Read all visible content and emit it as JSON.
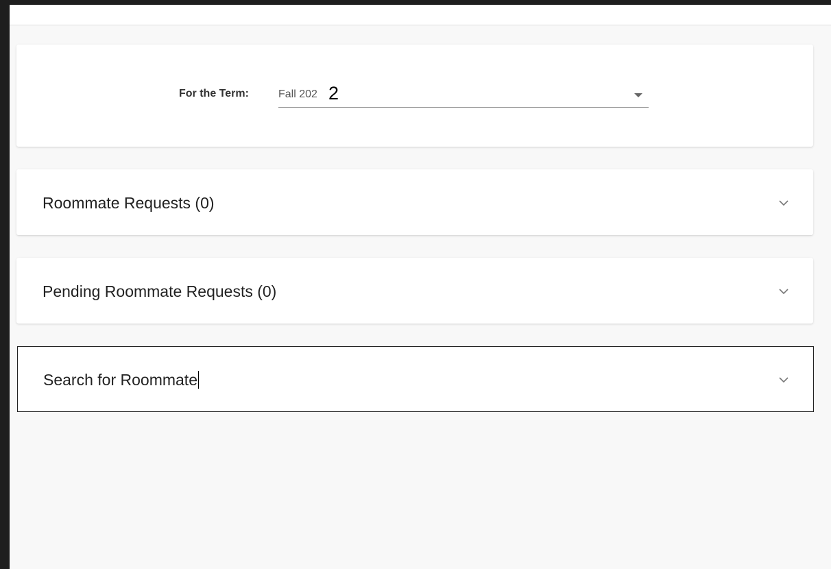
{
  "term": {
    "label": "For the Term:",
    "selected_value": "Fall 202",
    "overlay_digit": "2"
  },
  "panels": [
    {
      "title": "Roommate Requests (0)",
      "expand_icon": "chevron-down-icon"
    },
    {
      "title": "Pending Roommate Requests (0)",
      "expand_icon": "chevron-down-icon"
    },
    {
      "title": "Search for Roommate",
      "expand_icon": "chevron-down-icon"
    }
  ],
  "colors": {
    "page_background": "#f8f8f8",
    "card_background": "#ffffff",
    "frame": "#1e1e1e"
  }
}
